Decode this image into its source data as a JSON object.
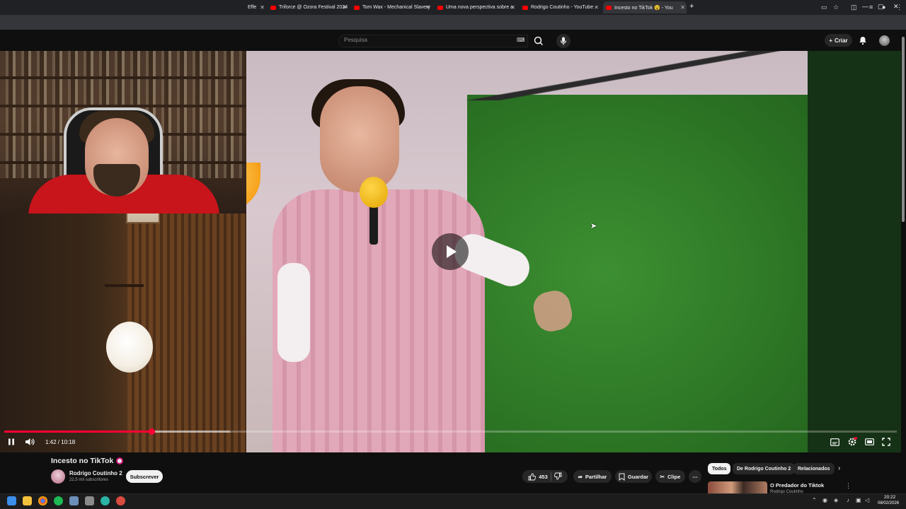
{
  "browser": {
    "tabs": [
      {
        "title": "Effe",
        "active": false
      },
      {
        "title": "Triforce @ Ozora Festival 2024",
        "active": false
      },
      {
        "title": "Tom Wax - Mechanical Slavery",
        "active": false
      },
      {
        "title": "Uma nova perspectiva sobre a",
        "active": false
      },
      {
        "title": "Rodrigo Coutinho - YouTube",
        "active": false
      },
      {
        "title": "Incesto no TikTok 😵 - You",
        "active": true
      }
    ],
    "new_tab_label": "+",
    "window_controls": [
      "—",
      "▢",
      "✕"
    ]
  },
  "youtube_header": {
    "search_placeholder": "Pesquisa",
    "create_label": "Criar"
  },
  "player": {
    "current_time": "1:42",
    "duration": "10:18",
    "time_display": "1:42 / 10:18",
    "played_fraction": 0.165,
    "loaded_fraction": 0.253,
    "state": "paused-overlay"
  },
  "video": {
    "title": "Incesto no TikTok",
    "channel_name": "Rodrigo Coutinho 2",
    "subscribers": "22,5 mil subscritores",
    "subscribe_label": "Subscrever",
    "like_count": "453",
    "share_label": "Partilhar",
    "save_label": "Guardar",
    "clip_label": "Clipe"
  },
  "sidebar": {
    "chips": [
      {
        "label": "Todos",
        "active": true
      },
      {
        "label": "De Rodrigo Coutinho 2",
        "active": false
      },
      {
        "label": "Relacionados",
        "active": false
      }
    ],
    "recommendation": {
      "title": "O Predador do Tiktok",
      "channel": "Rodrigo Coutinho"
    }
  },
  "taskbar": {
    "time": "20:22",
    "date": "08/02/2026"
  },
  "colors": {
    "accent": "#ff0033",
    "background": "#0f0f0f",
    "pill": "#272727"
  }
}
